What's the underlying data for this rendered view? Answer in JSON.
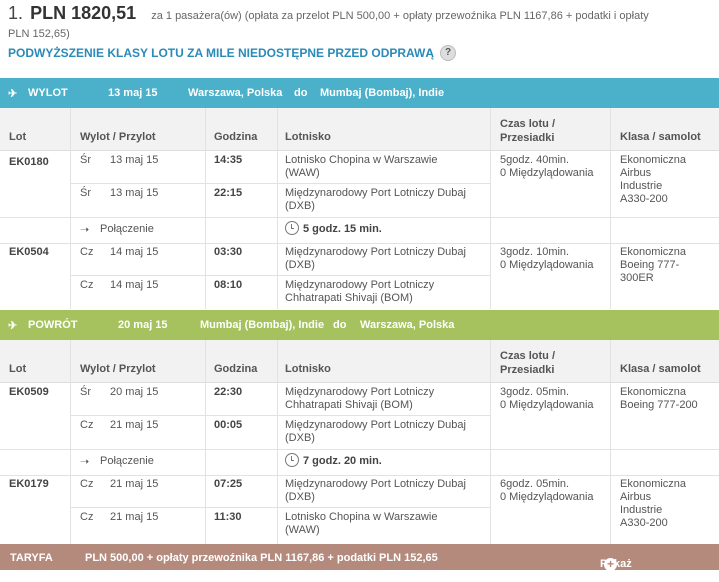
{
  "summary": {
    "index": "1.",
    "price": "PLN 1820,51",
    "desc_line1": "za 1 pasażera(ów) (opłata za przelot PLN 500,00 + opłaty przewoźnika PLN 1167,86 + podatki i opłaty",
    "desc_line2": "PLN 152,65)",
    "upgrade": "PODWYŻSZENIE KLASY LOTU ZA MILE NIEDOSTĘPNE PRZED ODPRAWĄ",
    "help": "?"
  },
  "columns": {
    "lot": "Lot",
    "wylot": "Wylot / Przylot",
    "godzina": "Godzina",
    "lotnisko": "Lotnisko",
    "czas1": "Czas lotu /",
    "czas2": "Przesiadki",
    "klasa": "Klasa / samolot"
  },
  "outbound": {
    "label": "WYLOT",
    "date": "13 maj 15",
    "from": "Warszawa, Polska",
    "to_word": "do",
    "to": "Mumbaj (Bombaj), Indie",
    "connection": "Połączenie",
    "connection_time": "5 godz. 15 min.",
    "flights": [
      {
        "no": "EK0180",
        "dep_day": "Śr",
        "dep_date": "13 maj 15",
        "dep_time": "14:35",
        "dep_airport1": "Lotnisko Chopina w Warszawie",
        "dep_airport2": "(WAW)",
        "arr_day": "Śr",
        "arr_date": "13 maj 15",
        "arr_time": "22:15",
        "arr_airport1": "Międzynarodowy Port Lotniczy Dubaj",
        "arr_airport2": "(DXB)",
        "duration": "5godz. 40min.",
        "stops": "0 Międzylądowania",
        "class": "Ekonomiczna",
        "plane1": "Airbus",
        "plane2": "Industrie",
        "plane3": "A330-200"
      },
      {
        "no": "EK0504",
        "dep_day": "Cz",
        "dep_date": "14 maj 15",
        "dep_time": "03:30",
        "dep_airport1": "Międzynarodowy Port Lotniczy Dubaj",
        "dep_airport2": "(DXB)",
        "arr_day": "Cz",
        "arr_date": "14 maj 15",
        "arr_time": "08:10",
        "arr_airport1": "Międzynarodowy Port Lotniczy",
        "arr_airport2": "Chhatrapati Shivaji (BOM)",
        "duration": "3godz. 10min.",
        "stops": "0 Międzylądowania",
        "class": "Ekonomiczna",
        "plane1": "Boeing 777-",
        "plane2": "300ER",
        "plane3": ""
      }
    ]
  },
  "return": {
    "label": "POWRÓT",
    "date": "20 maj 15",
    "from": "Mumbaj (Bombaj), Indie",
    "to_word": "do",
    "to": "Warszawa, Polska",
    "connection": "Połączenie",
    "connection_time": "7 godz. 20 min.",
    "flights": [
      {
        "no": "EK0509",
        "dep_day": "Śr",
        "dep_date": "20 maj 15",
        "dep_time": "22:30",
        "dep_airport1": "Międzynarodowy Port Lotniczy",
        "dep_airport2": "Chhatrapati Shivaji (BOM)",
        "arr_day": "Cz",
        "arr_date": "21 maj 15",
        "arr_time": "00:05",
        "arr_airport1": "Międzynarodowy Port Lotniczy Dubaj",
        "arr_airport2": "(DXB)",
        "duration": "3godz. 05min.",
        "stops": "0 Międzylądowania",
        "class": "Ekonomiczna",
        "plane1": "Boeing 777-200",
        "plane2": "",
        "plane3": ""
      },
      {
        "no": "EK0179",
        "dep_day": "Cz",
        "dep_date": "21 maj 15",
        "dep_time": "07:25",
        "dep_airport1": "Międzynarodowy Port Lotniczy Dubaj",
        "dep_airport2": "(DXB)",
        "arr_day": "Cz",
        "arr_date": "21 maj 15",
        "arr_time": "11:30",
        "arr_airport1": "Lotnisko Chopina w Warszawie",
        "arr_airport2": "(WAW)",
        "duration": "6godz. 05min.",
        "stops": "0 Międzylądowania",
        "class": "Ekonomiczna",
        "plane1": "Airbus",
        "plane2": "Industrie",
        "plane3": "A330-200"
      }
    ]
  },
  "footer": {
    "label": "TARYFA",
    "text": "PLN 500,00 + opłaty przewoźnika PLN 1167,86 + podatki PLN 152,65",
    "details": "Pokaż szczegóły",
    "plus": "+"
  },
  "icons": {
    "plane": "plane-icon",
    "clock": "clock-icon",
    "connection": "connection-arrow-icon"
  },
  "colors": {
    "outbound": "#4bb0c9",
    "return": "#a5c25e",
    "footer": "#b48a7c",
    "link": "#2a8ab8"
  }
}
